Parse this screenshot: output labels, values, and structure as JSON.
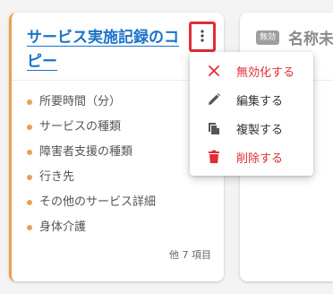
{
  "card": {
    "title": "サービス実施記録のコピー",
    "fields": [
      "所要時間（分）",
      "サービスの種類",
      "障害者支援の種類",
      "行き先",
      "その他のサービス詳細",
      "身体介護"
    ],
    "more_count": "他 7 項目",
    "accent_color": "#e8a055",
    "menu_button_icon": "more-vert-icon"
  },
  "card2": {
    "badge": "無効",
    "title": "名称未"
  },
  "menu": {
    "items": [
      {
        "label": "無効化する",
        "icon": "close-icon",
        "color": "#e02e37"
      },
      {
        "label": "編集する",
        "icon": "pencil-icon",
        "color": "#333333"
      },
      {
        "label": "複製する",
        "icon": "copy-icon",
        "color": "#333333"
      },
      {
        "label": "削除する",
        "icon": "trash-icon",
        "color": "#e02e37"
      }
    ]
  }
}
